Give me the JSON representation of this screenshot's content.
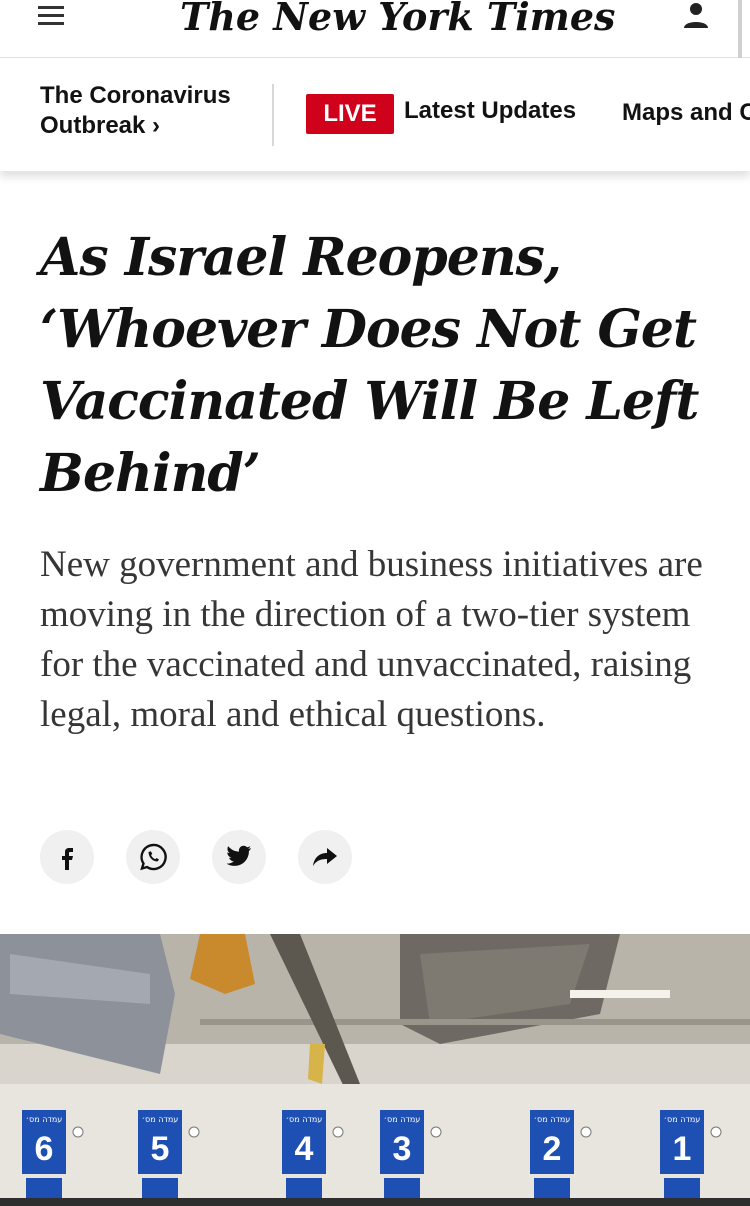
{
  "masthead": {
    "logo_text": "The New York Times",
    "menu_icon": "hamburger-menu-icon",
    "account_icon": "account-icon"
  },
  "nav": {
    "section_line1": "The Coronavirus",
    "section_line2": "Outbreak ›",
    "live_badge": "LIVE",
    "latest_updates": "Latest Updates",
    "maps": "Maps and C",
    "live_color": "#d0021b"
  },
  "article": {
    "headline": "As Israel Reopens, ‘Whoever Does Not Get Vaccinated Will Be Left Behind’",
    "summary": "New government and business initiatives are moving in the direction of a two-tier system for the vaccinated and unvaccinated, raising legal, moral and ethical questions."
  },
  "share": {
    "icons": [
      "facebook-icon",
      "whatsapp-icon",
      "twitter-icon",
      "share-arrow-icon"
    ]
  },
  "photo": {
    "station_numbers": [
      "6",
      "5",
      "4",
      "3",
      "2",
      "1"
    ],
    "station_label": "עמדה מס׳",
    "sign_color": "#1e4fb3"
  }
}
